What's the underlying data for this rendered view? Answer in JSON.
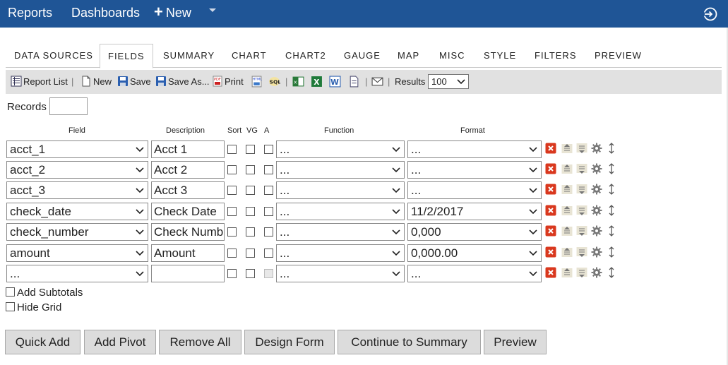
{
  "topnav": {
    "reports": "Reports",
    "dashboards": "Dashboards",
    "new_label": "New",
    "new_plus": "+"
  },
  "tabs": [
    {
      "label": "DATA SOURCES"
    },
    {
      "label": "FIELDS"
    },
    {
      "label": "SUMMARY"
    },
    {
      "label": "CHART"
    },
    {
      "label": "CHART2"
    },
    {
      "label": "GAUGE"
    },
    {
      "label": "MAP"
    },
    {
      "label": "MISC"
    },
    {
      "label": "STYLE"
    },
    {
      "label": "FILTERS"
    },
    {
      "label": "PREVIEW"
    }
  ],
  "active_tab": "FIELDS",
  "toolbar": {
    "report_list": "Report List",
    "new": "New",
    "save": "Save",
    "save_as": "Save As...",
    "print": "Print",
    "results_label": "Results",
    "results_value": "100",
    "sep": "|"
  },
  "records": {
    "label": "Records",
    "value": ""
  },
  "columns": {
    "field": "Field",
    "description": "Description",
    "sort": "Sort",
    "vg": "VG",
    "a": "A",
    "function": "Function",
    "format": "Format"
  },
  "rows": [
    {
      "field": "acct_1",
      "description": "Acct 1",
      "function": "...",
      "format": "..."
    },
    {
      "field": "acct_2",
      "description": "Acct 2",
      "function": "...",
      "format": "..."
    },
    {
      "field": "acct_3",
      "description": "Acct 3",
      "function": "...",
      "format": "..."
    },
    {
      "field": "check_date",
      "description": "Check Date",
      "function": "...",
      "format": "11/2/2017"
    },
    {
      "field": "check_number",
      "description": "Check Numb",
      "function": "...",
      "format": "0,000"
    },
    {
      "field": "amount",
      "description": "Amount",
      "function": "...",
      "format": "0,000.00"
    },
    {
      "field": "...",
      "description": "",
      "function": "...",
      "format": "..."
    }
  ],
  "options": {
    "add_subtotals": "Add Subtotals",
    "hide_grid": "Hide Grid"
  },
  "buttons": {
    "quick_add": "Quick Add",
    "add_pivot": "Add Pivot",
    "remove_all": "Remove All",
    "design_form": "Design Form",
    "continue_to_summary": "Continue to Summary",
    "preview": "Preview"
  },
  "colors": {
    "nav_bg": "#1f5596",
    "toolbar_bg": "#e1e1e1",
    "delete_red": "#d9381e",
    "button_bg": "#dcdcdc"
  },
  "icons": {
    "row_actions": [
      "delete-icon",
      "move-up-icon",
      "move-down-icon",
      "settings-gear-icon",
      "drag-handle-icon"
    ],
    "topbar": [
      "logout-icon"
    ]
  }
}
